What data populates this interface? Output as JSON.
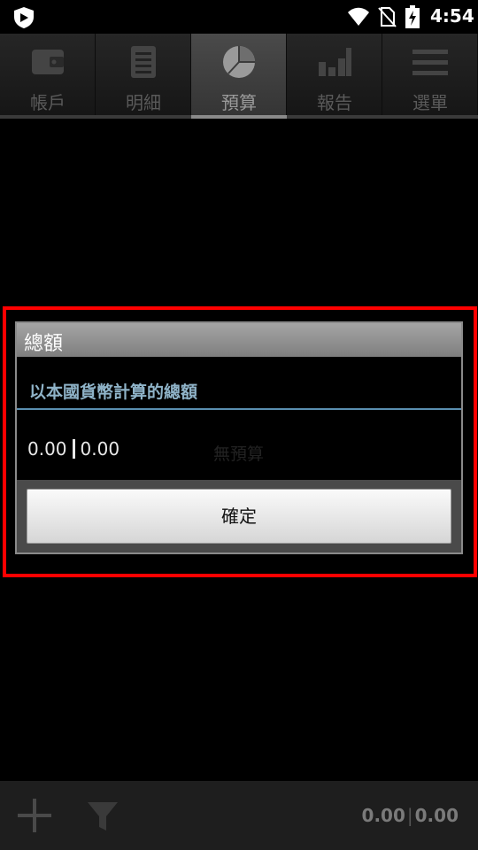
{
  "status_bar": {
    "time": "4:54",
    "icons": [
      "shield-icon",
      "wifi-icon",
      "no-sim-icon",
      "battery-charging-icon"
    ]
  },
  "tabs": [
    {
      "label": "帳戶",
      "icon": "wallet-icon",
      "active": false
    },
    {
      "label": "明細",
      "icon": "document-list-icon",
      "active": false
    },
    {
      "label": "預算",
      "icon": "pie-chart-icon",
      "active": true
    },
    {
      "label": "報告",
      "icon": "bar-chart-icon",
      "active": false
    },
    {
      "label": "選單",
      "icon": "menu-icon",
      "active": false
    }
  ],
  "dialog": {
    "title": "總額",
    "subtitle": "以本國貨幣計算的總額",
    "value_left": "0.00",
    "value_right": "0.00",
    "confirm_label": "確定"
  },
  "background": {
    "no_budget_text": "無預算"
  },
  "bottom_bar": {
    "total_left": "0.00",
    "total_right": "0.00",
    "icons": [
      "add-icon",
      "filter-icon"
    ]
  },
  "colors": {
    "highlight": "#ff0000",
    "subtitle": "#8fb3c8",
    "divider": "#5a8fb0"
  }
}
